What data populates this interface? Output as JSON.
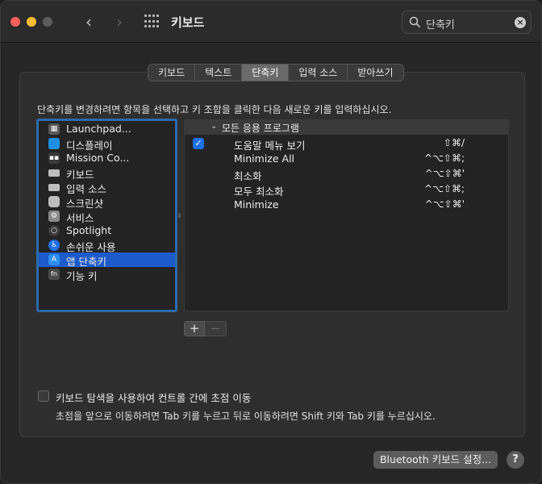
{
  "window": {
    "title": "키보드",
    "nav_back": "‹",
    "nav_forward": "›"
  },
  "search": {
    "value": "단축키",
    "clear": "×"
  },
  "tabs": [
    {
      "label": "키보드",
      "active": false
    },
    {
      "label": "텍스트",
      "active": false
    },
    {
      "label": "단축키",
      "active": true
    },
    {
      "label": "입력 소스",
      "active": false
    },
    {
      "label": "받아쓰기",
      "active": false
    }
  ],
  "description": "단축키를 변경하려면 항목을 선택하고 키 조합을 클릭한 다음 새로운 키를 입력하십시오.",
  "categories": [
    {
      "label": "Launchpad...",
      "icon": "launchpad-icon",
      "color": "#5a5a5a"
    },
    {
      "label": "디스플레이",
      "icon": "display-icon",
      "color": "#1e8fe0"
    },
    {
      "label": "Mission Co...",
      "icon": "mission-control-icon",
      "color": "#3a3a3a"
    },
    {
      "label": "키보드",
      "icon": "keyboard-icon",
      "color": "#bdbdbd"
    },
    {
      "label": "입력 소스",
      "icon": "input-source-icon",
      "color": "#bdbdbd"
    },
    {
      "label": "스크린샷",
      "icon": "screenshot-icon",
      "color": "#bdbdbd"
    },
    {
      "label": "서비스",
      "icon": "services-gear-icon",
      "color": "#8a8a8a"
    },
    {
      "label": "Spotlight",
      "icon": "spotlight-search-icon",
      "color": "#3a3a3a"
    },
    {
      "label": "손쉬운 사용",
      "icon": "accessibility-icon",
      "color": "#1f6fe5"
    },
    {
      "label": "앱 단축키",
      "icon": "app-shortcuts-icon",
      "color": "#2b8ef0",
      "selected": true
    },
    {
      "label": "기능 키",
      "icon": "fn-key-icon",
      "color": "#4a4a4a"
    }
  ],
  "shortcuts": {
    "group_label": "모든 응용 프로그램",
    "rows": [
      {
        "name": "도움말 메뉴 보기",
        "keys": "⇧⌘/",
        "checked": true
      },
      {
        "name": "Minimize All",
        "keys": "^⌥⇧⌘;",
        "checked": false
      },
      {
        "name": "최소화",
        "keys": "^⌥⇧⌘'",
        "checked": false
      },
      {
        "name": "모두 최소화",
        "keys": "^⌥⇧⌘;",
        "checked": false
      },
      {
        "name": "Minimize",
        "keys": "^⌥⇧⌘'",
        "checked": false
      }
    ]
  },
  "buttons": {
    "add": "+",
    "remove": "−",
    "bluetooth": "Bluetooth 키보드 설정...",
    "help": "?"
  },
  "keyboard_nav": {
    "label": "키보드 탐색을 사용하여 컨트롤 간에 초점 이동",
    "hint": "초점을 앞으로 이동하려면 Tab 키를 누르고 뒤로 이동하려면 Shift 키와 Tab 키를 누르십시오.",
    "checked": false
  }
}
